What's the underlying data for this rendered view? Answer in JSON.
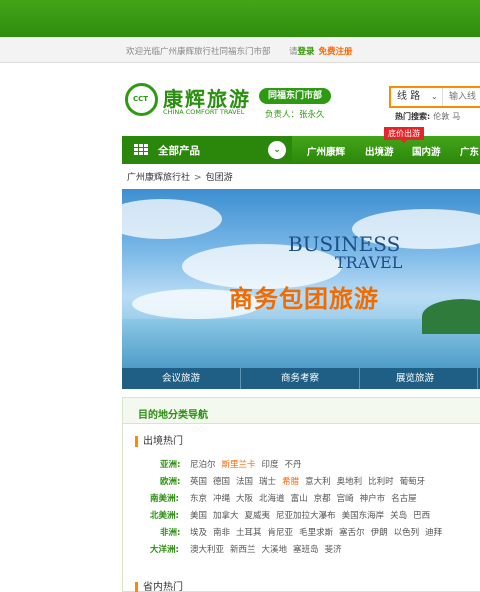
{
  "welcome_bar": {
    "text": "欢迎光临广州康辉旅行社同福东门市部",
    "prompt": "请",
    "login": "登录",
    "register": "免费注册"
  },
  "header": {
    "logo_text": "CCT",
    "brand_cn": "康辉旅游",
    "brand_en": "CHINA COMFORT TRAVEL",
    "branch": "同福东门市部",
    "manager": "负责人：张永久"
  },
  "search": {
    "category": "线 路",
    "placeholder": "输入线",
    "hot_label": "热门搜索:",
    "hot_terms": [
      "伦敦",
      "马"
    ]
  },
  "nav": {
    "all_products": "全部产品",
    "items": [
      "广州康辉",
      "出境游",
      "国内游",
      "广东"
    ],
    "hot_tag": "底价出游"
  },
  "breadcrumb": [
    "广州康辉旅行社",
    "包团游"
  ],
  "banner": {
    "en_line1": "BUSINESS",
    "en_line2": "TRAVEL",
    "cn_title": "商务包团旅游",
    "tabs": [
      "会议旅游",
      "商务考察",
      "展览旅游"
    ]
  },
  "destinations": {
    "title": "目的地分类导航",
    "outbound": {
      "title": "出境热门",
      "regions": [
        {
          "name": "亚洲:",
          "places": [
            "尼泊尔",
            "斯里兰卡",
            "印度",
            "不丹"
          ],
          "highlight": [
            1
          ]
        },
        {
          "name": "欧洲:",
          "places": [
            "英国",
            "德国",
            "法国",
            "瑞士",
            "希腊",
            "意大利",
            "奥地利",
            "比利时",
            "葡萄牙"
          ],
          "highlight": [
            4
          ]
        },
        {
          "name": "南美洲:",
          "places": [
            "东京",
            "冲绳",
            "大阪",
            "北海道",
            "富山",
            "京都",
            "宫崎",
            "神户市",
            "名古屋"
          ],
          "highlight": []
        },
        {
          "name": "北美洲:",
          "places": [
            "美国",
            "加拿大",
            "夏威夷",
            "尼亚加拉大瀑布",
            "美国东海岸",
            "关岛",
            "巴西"
          ],
          "highlight": []
        },
        {
          "name": "非洲:",
          "places": [
            "埃及",
            "南非",
            "土耳其",
            "肯尼亚",
            "毛里求斯",
            "塞舌尔",
            "伊朗",
            "以色列",
            "迪拜"
          ],
          "highlight": []
        },
        {
          "name": "大洋洲:",
          "places": [
            "澳大利亚",
            "新西兰",
            "大溪地",
            "塞班岛",
            "斐济"
          ],
          "highlight": []
        }
      ]
    },
    "domestic": {
      "title": "省内热门"
    }
  },
  "colors": {
    "brand_green": "#2b8f10",
    "accent_orange": "#ff6600",
    "hot_red": "#e4262b"
  }
}
